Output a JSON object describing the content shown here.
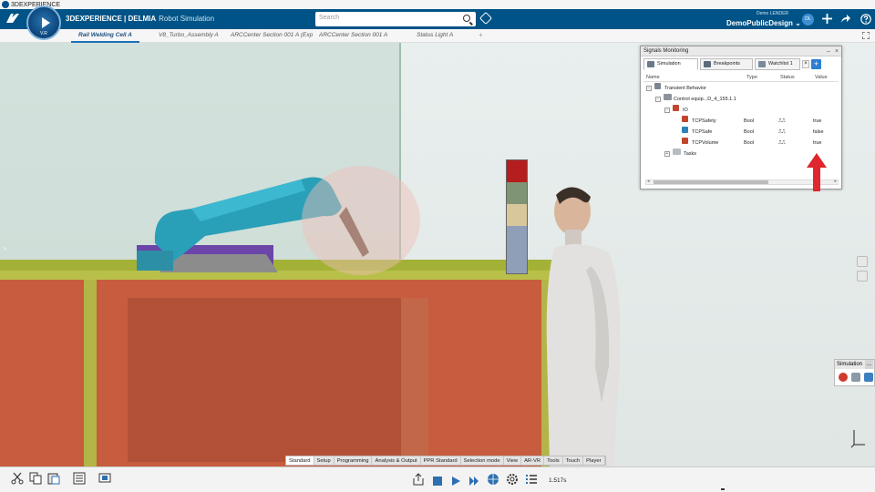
{
  "os_window": {
    "title": "3DEXPERIENCE"
  },
  "topbar": {
    "brand": "3DEXPERIENCE | DELMIA",
    "app_name": "Robot Simulation",
    "compass_version": "V.R",
    "search_placeholder": "Search",
    "user_small": "Demo LENDER",
    "user_space": "DemoPublicDesign ⌄",
    "avatar_initials": "DL",
    "icons": [
      "tag-icon",
      "add-icon",
      "share-icon",
      "help-icon"
    ]
  },
  "tabs": [
    {
      "label": "Rail Welding Cell A",
      "active": true
    },
    {
      "label": "V8_Turbo_Assembly A",
      "active": false
    },
    {
      "label": "ARCCenter Section 001 A (Exp",
      "active": false
    },
    {
      "label": "ARCCenter Section 001 A",
      "active": false
    },
    {
      "label": "Status Light A",
      "active": false
    }
  ],
  "tab_add": "+",
  "signals_panel": {
    "title": "Signals Monitoring",
    "controls": [
      "–",
      "×"
    ],
    "tabs": [
      {
        "label": "Simulation",
        "active": true
      },
      {
        "label": "Breakpoints",
        "active": false
      },
      {
        "label": "Watchlist 1",
        "active": false
      }
    ],
    "tab_close": "×",
    "columns": [
      "Name",
      "Type",
      "Status",
      "Value"
    ],
    "tree": [
      {
        "label": "Transient Behavior",
        "level": 0,
        "expander": "−"
      },
      {
        "label": "Control equip...D_4_155.1.1",
        "level": 1,
        "expander": "−"
      },
      {
        "label": "IO",
        "level": 2,
        "expander": "−"
      },
      {
        "label": "TCPSafety",
        "level": 3,
        "type": "Bool",
        "status": "⎍⎍",
        "value": "true"
      },
      {
        "label": "TCPSafe",
        "level": 3,
        "type": "Bool",
        "status": "⎍⎍",
        "value": "false"
      },
      {
        "label": "TCPVolume",
        "level": 3,
        "type": "Bool",
        "status": "⎍⎍",
        "value": "true"
      },
      {
        "label": "Tasks",
        "level": 2,
        "expander": "+"
      }
    ]
  },
  "sim_mini_panel": {
    "title": "Simulation",
    "more": "..."
  },
  "action_bar": {
    "tabs": [
      {
        "label": "Standard",
        "active": true
      },
      {
        "label": "Setup",
        "active": false
      },
      {
        "label": "Programming",
        "active": false
      },
      {
        "label": "Analysis & Output",
        "active": false
      },
      {
        "label": "PPR Standard",
        "active": false
      },
      {
        "label": "Selection mode",
        "active": false
      },
      {
        "label": "View",
        "active": false
      },
      {
        "label": "AR-VR",
        "active": false
      },
      {
        "label": "Tools",
        "active": false
      },
      {
        "label": "Touch",
        "active": false
      },
      {
        "label": "Player",
        "active": false
      }
    ]
  },
  "player": {
    "time": "1.517s"
  },
  "colors": {
    "topbar": "#005386",
    "accent": "#1d6fb6",
    "cabinet": "#c75c3e",
    "robot": "#2aa0b8",
    "annotation_arrow": "#e0262e"
  }
}
